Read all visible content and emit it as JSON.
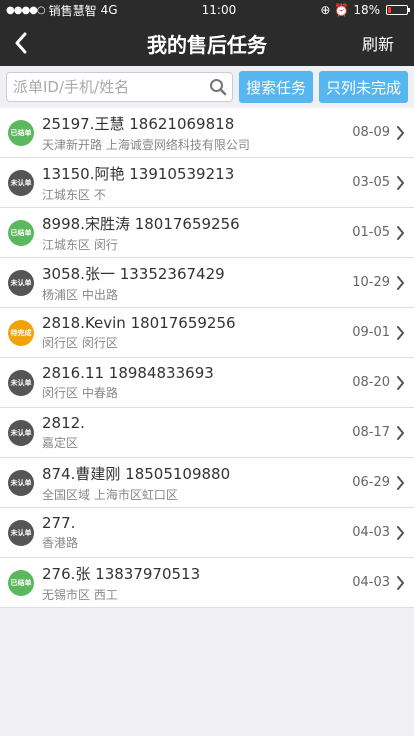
{
  "status": {
    "carrier": "销售慧智",
    "network": "4G",
    "time": "11:00",
    "battery": "18%",
    "battery_level": 0.18
  },
  "header": {
    "back_icon": "chevron-left-icon",
    "title": "我的售后任务",
    "refresh_label": "刷新"
  },
  "search": {
    "placeholder": "派单ID/手机/姓名",
    "value": "",
    "search_button": "搜索任务",
    "filter_button": "只列未完成"
  },
  "colors": {
    "done": "#5cb85c",
    "unconfirmed": "#555555",
    "pending": "#f0a30a",
    "accent": "#56b6ef"
  },
  "tasks": [
    {
      "status": "已结单",
      "type": "done",
      "title": "25197.王慧 18621069818",
      "address": "天津新开路 上海诚壹网络科技有限公司",
      "date": "08-09"
    },
    {
      "status": "未认单",
      "type": "unconfirmed",
      "title": "13150.阿艳 13910539213",
      "address": "江城东区 不",
      "date": "03-05"
    },
    {
      "status": "已结单",
      "type": "done",
      "title": "8998.宋胜涛 18017659256",
      "address": "江城东区 闵行",
      "date": "01-05"
    },
    {
      "status": "未认单",
      "type": "unconfirmed",
      "title": "3058.张一 13352367429",
      "address": "杨浦区 中出路",
      "date": "10-29"
    },
    {
      "status": "待完成",
      "type": "pending",
      "title": "2818.Kevin 18017659256",
      "address": "闵行区 闵行区",
      "date": "09-01"
    },
    {
      "status": "未认单",
      "type": "unconfirmed",
      "title": "2816.11 18984833693",
      "address": "闵行区 中春路",
      "date": "08-20"
    },
    {
      "status": "未认单",
      "type": "unconfirmed",
      "title": "2812.",
      "address": "嘉定区",
      "date": "08-17"
    },
    {
      "status": "未认单",
      "type": "unconfirmed",
      "title": "874.曹建刚 18505109880",
      "address": "全国区域 上海市区虹口区",
      "date": "06-29"
    },
    {
      "status": "未认单",
      "type": "unconfirmed",
      "title": "277.",
      "address": "香港路",
      "date": "04-03"
    },
    {
      "status": "已结单",
      "type": "done",
      "title": "276.张 13837970513",
      "address": "无锡市区 西工",
      "date": "04-03"
    }
  ]
}
